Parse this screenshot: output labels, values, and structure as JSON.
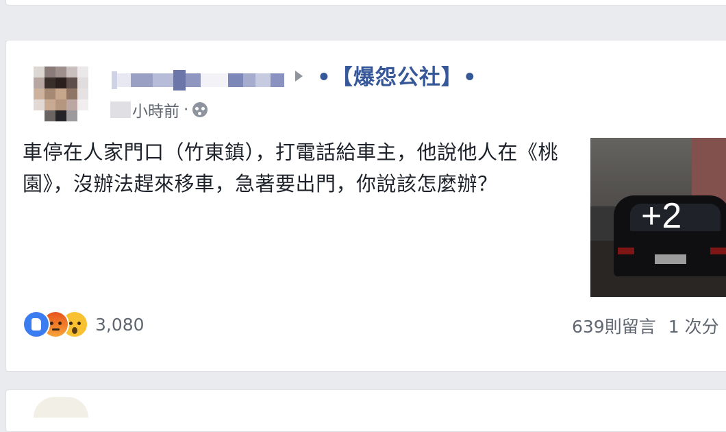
{
  "post": {
    "author_name": "",
    "group_name": "•【爆怨公社】•",
    "timestamp": "小時前",
    "meta_separator": "·",
    "privacy_icon": "globe-icon",
    "text": "車停在人家門口（竹東鎮），打電話給車主，他說他人在《桃園》，沒辦法趕來移車，急著要出門，你說該怎麼辦？",
    "photo": {
      "more_count_label": "+2"
    },
    "reactions": {
      "icons": [
        "like-icon",
        "angry-icon",
        "wow-icon"
      ],
      "count": "3,080"
    },
    "comments_label": "639則留言",
    "shares_label": "1 次分"
  },
  "colors": {
    "background": "#e9ebee",
    "card": "#ffffff",
    "link_blue": "#365899",
    "text": "#1d2129",
    "meta_gray": "#616770"
  }
}
